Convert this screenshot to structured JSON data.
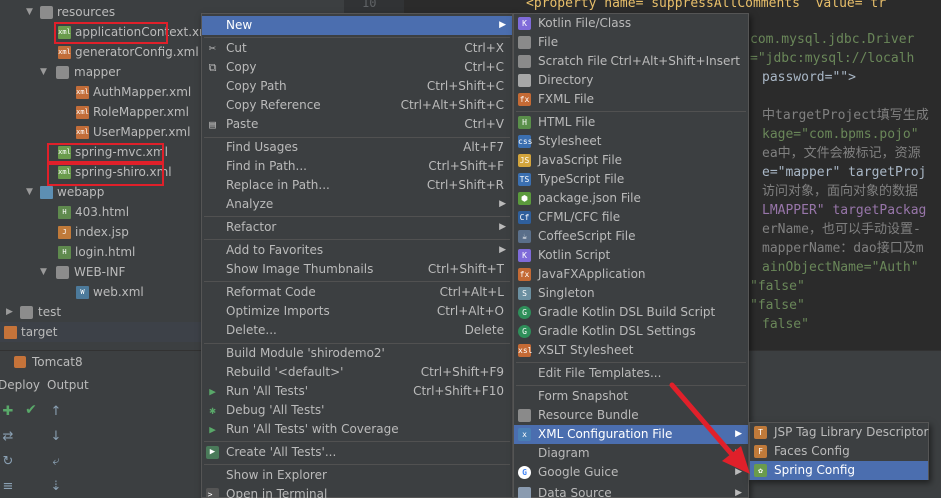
{
  "project_tree": {
    "items": [
      {
        "label": "resources"
      },
      {
        "label": "applicationContext.xml"
      },
      {
        "label": "generatorConfig.xml"
      },
      {
        "label": "mapper"
      },
      {
        "label": "AuthMapper.xml"
      },
      {
        "label": "RoleMapper.xml"
      },
      {
        "label": "UserMapper.xml"
      },
      {
        "label": "spring-mvc.xml"
      },
      {
        "label": "spring-shiro.xml"
      },
      {
        "label": "webapp"
      },
      {
        "label": "403.html"
      },
      {
        "label": "index.jsp"
      },
      {
        "label": "login.html"
      },
      {
        "label": "WEB-INF"
      },
      {
        "label": "web.xml"
      },
      {
        "label": "test"
      },
      {
        "label": "target"
      }
    ]
  },
  "editor": {
    "line_number": "10",
    "lines": [
      "<property name= suppressAllComments  value= tr",
      "com.mysql.jdbc.Driver",
      "=\"jdbc:mysql://localh",
      "password=\"\">",
      "中targetProject填写生成",
      "kage=\"com.bpms.pojo\"",
      "ea中，文件会被标记，资源",
      "e=\"mapper\" targetProj",
      "访问对象，面向对象的数据",
      "LMAPPER\" targetPackag",
      "erName，也可以手动设置-",
      "mapperName：dao接口及m",
      "ainObjectName=\"Auth\"",
      "\"false\"",
      "\"false\"",
      "false\""
    ]
  },
  "bottom_panel": {
    "run_config": "Tomcat8",
    "tabs": [
      "Deploy",
      "Output"
    ]
  },
  "context_menu": {
    "items": [
      {
        "label": "New",
        "shortcut": "",
        "submenu": true,
        "selected": true
      },
      {
        "label": "Cut",
        "shortcut": "Ctrl+X",
        "icon": "cut-icon"
      },
      {
        "label": "Copy",
        "shortcut": "Ctrl+C",
        "icon": "copy-icon"
      },
      {
        "label": "Copy Path",
        "shortcut": "Ctrl+Shift+C"
      },
      {
        "label": "Copy Reference",
        "shortcut": "Ctrl+Alt+Shift+C"
      },
      {
        "label": "Paste",
        "shortcut": "Ctrl+V",
        "icon": "paste-icon"
      },
      {
        "label": "Find Usages",
        "shortcut": "Alt+F7"
      },
      {
        "label": "Find in Path...",
        "shortcut": "Ctrl+Shift+F"
      },
      {
        "label": "Replace in Path...",
        "shortcut": "Ctrl+Shift+R"
      },
      {
        "label": "Analyze",
        "shortcut": "",
        "submenu": true
      },
      {
        "label": "Refactor",
        "shortcut": "",
        "submenu": true
      },
      {
        "label": "Add to Favorites",
        "shortcut": "",
        "submenu": true
      },
      {
        "label": "Show Image Thumbnails",
        "shortcut": "Ctrl+Shift+T"
      },
      {
        "label": "Reformat Code",
        "shortcut": "Ctrl+Alt+L"
      },
      {
        "label": "Optimize Imports",
        "shortcut": "Ctrl+Alt+O"
      },
      {
        "label": "Delete...",
        "shortcut": "Delete"
      },
      {
        "label": "Build Module 'shirodemo2'",
        "shortcut": ""
      },
      {
        "label": "Rebuild '<default>'",
        "shortcut": "Ctrl+Shift+F9"
      },
      {
        "label": "Run 'All Tests'",
        "shortcut": "Ctrl+Shift+F10",
        "icon": "run-icon"
      },
      {
        "label": "Debug 'All Tests'",
        "shortcut": "",
        "icon": "debug-icon"
      },
      {
        "label": "Run 'All Tests' with Coverage",
        "shortcut": "",
        "icon": "coverage-icon"
      },
      {
        "label": "Create 'All Tests'...",
        "shortcut": "",
        "icon": "create-test-icon"
      },
      {
        "label": "Show in Explorer",
        "shortcut": ""
      },
      {
        "label": "Open in Terminal",
        "shortcut": "",
        "icon": "terminal-icon"
      }
    ]
  },
  "new_menu": {
    "items": [
      {
        "label": "Kotlin File/Class",
        "shortcut": "",
        "icon": "kotlin-icon"
      },
      {
        "label": "File",
        "shortcut": "",
        "icon": "file-icon"
      },
      {
        "label": "Scratch File",
        "shortcut": "Ctrl+Alt+Shift+Insert",
        "icon": "scratch-file-icon"
      },
      {
        "label": "Directory",
        "shortcut": "",
        "icon": "directory-icon"
      },
      {
        "label": "FXML File",
        "shortcut": "",
        "icon": "fxml-icon"
      },
      {
        "label": "HTML File",
        "shortcut": "",
        "icon": "html-icon"
      },
      {
        "label": "Stylesheet",
        "shortcut": "",
        "icon": "css-icon"
      },
      {
        "label": "JavaScript File",
        "shortcut": "",
        "icon": "javascript-icon"
      },
      {
        "label": "TypeScript File",
        "shortcut": "",
        "icon": "typescript-icon"
      },
      {
        "label": "package.json File",
        "shortcut": "",
        "icon": "nodejs-icon"
      },
      {
        "label": "CFML/CFC file",
        "shortcut": "",
        "icon": "cfml-icon"
      },
      {
        "label": "CoffeeScript File",
        "shortcut": "",
        "icon": "coffeescript-icon"
      },
      {
        "label": "Kotlin Script",
        "shortcut": "",
        "icon": "kotlin-script-icon"
      },
      {
        "label": "JavaFXApplication",
        "shortcut": "",
        "icon": "javafx-icon"
      },
      {
        "label": "Singleton",
        "shortcut": "",
        "icon": "singleton-icon"
      },
      {
        "label": "Gradle Kotlin DSL Build Script",
        "shortcut": "",
        "icon": "gradle-icon"
      },
      {
        "label": "Gradle Kotlin DSL Settings",
        "shortcut": "",
        "icon": "gradle-settings-icon"
      },
      {
        "label": "XSLT Stylesheet",
        "shortcut": "",
        "icon": "xslt-icon"
      },
      {
        "label": "Edit File Templates...",
        "shortcut": ""
      },
      {
        "label": "Form Snapshot",
        "shortcut": ""
      },
      {
        "label": "Resource Bundle",
        "shortcut": "",
        "icon": "resource-bundle-icon"
      },
      {
        "label": "XML Configuration File",
        "shortcut": "",
        "icon": "xml-config-icon",
        "submenu": true,
        "selected": true
      },
      {
        "label": "Diagram",
        "shortcut": "",
        "icon": "diagram-icon",
        "submenu": true
      },
      {
        "label": "Google Guice",
        "shortcut": "",
        "icon": "google-icon",
        "submenu": true
      },
      {
        "label": "Data Source",
        "shortcut": "",
        "icon": "data-source-icon",
        "submenu": true
      }
    ]
  },
  "xml_submenu": {
    "items": [
      {
        "label": "JSP Tag Library Descriptor",
        "icon": "jsp-tld-icon"
      },
      {
        "label": "Faces Config",
        "icon": "faces-config-icon"
      },
      {
        "label": "Spring Config",
        "icon": "spring-icon",
        "selected": true
      }
    ]
  },
  "colors": {
    "menu_bg": "#3c3f41",
    "selection": "#4b6eaf",
    "annotation_red": "#e0202a"
  }
}
